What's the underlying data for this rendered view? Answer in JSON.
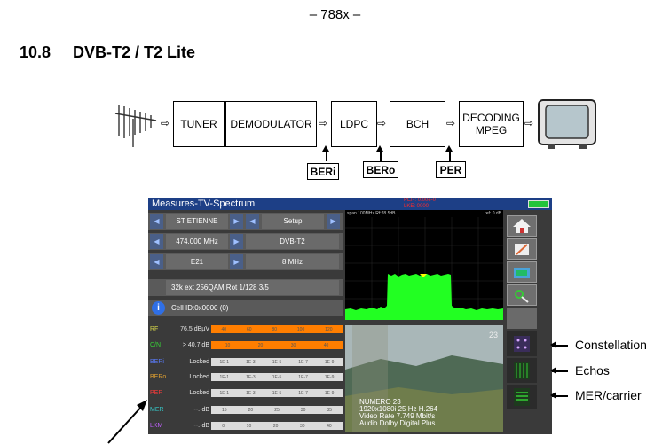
{
  "page_number": "– 788x –",
  "section": {
    "number": "10.8",
    "title": "DVB-T2 / T2 Lite"
  },
  "diagram": {
    "blocks": [
      "TUNER",
      "DEMODULATOR",
      "LDPC",
      "BCH",
      "DECODING MPEG"
    ],
    "measure_points": [
      "BERi",
      "BERo",
      "PER"
    ]
  },
  "screen": {
    "title": "Measures-TV-Spectrum",
    "status_top": "PER: 0.00e-0",
    "status_bottom": "LKE: 0000",
    "spectrum_header_left": "span 100MHz  Rf:28.5dB",
    "spectrum_header_right": "ref: 0 dB",
    "rows": {
      "location": "ST ETIENNE",
      "setup": "Setup",
      "frequency": "474.000 MHz",
      "standard": "DVB-T2",
      "channel": "E21",
      "bandwidth": "8 MHz",
      "modulation": "32k ext 256QAM Rot 1/128 3/5",
      "cell_id": "Cell ID:0x0000 (0)"
    },
    "measures": [
      {
        "label": "RF",
        "value": "76.5 dBµV",
        "color": "#d9d94a",
        "scale": [
          "40",
          "60",
          "80",
          "100",
          "120"
        ],
        "style": "orange"
      },
      {
        "label": "C/N",
        "value": "> 40.7 dB",
        "color": "#37d137",
        "scale": [
          "10",
          "20",
          "30",
          "40"
        ],
        "style": "orange"
      },
      {
        "label": "BERi",
        "value": "Locked",
        "color": "#5a7cff",
        "scale": [
          "1E-1",
          "1E-3",
          "1E-5",
          "1E-7",
          "1E-9"
        ],
        "style": "plain"
      },
      {
        "label": "BERo",
        "value": "Locked",
        "color": "#e0a030",
        "scale": [
          "1E-1",
          "1E-3",
          "1E-5",
          "1E-7",
          "1E-9"
        ],
        "style": "plain"
      },
      {
        "label": "PER",
        "value": "Locked",
        "color": "#ff3a3a",
        "scale": [
          "1E-1",
          "1E-3",
          "1E-5",
          "1E-7",
          "1E-9"
        ],
        "style": "plain"
      },
      {
        "label": "MER",
        "value": "--.-dB",
        "color": "#36c9c9",
        "scale": [
          "15",
          "20",
          "25",
          "30",
          "35"
        ],
        "style": "plain"
      },
      {
        "label": "LKM",
        "value": "--.-dB",
        "color": "#c060ff",
        "scale": [
          "0",
          "10",
          "20",
          "30",
          "40"
        ],
        "style": "plain"
      }
    ],
    "video": {
      "channel_number": "23",
      "caption_lines": [
        "NUMERO 23",
        "1920x1080i 25 Hz H.264",
        "Video Rate 7.749 Mbit/s",
        "Audio Dolby Digital Plus"
      ]
    }
  },
  "callouts": [
    "Constellation",
    "Echos",
    "MER/carrier"
  ]
}
